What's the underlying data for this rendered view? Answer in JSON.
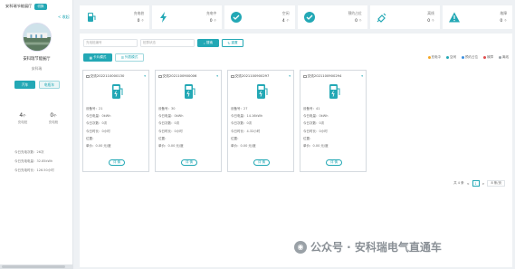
{
  "sidebar": {
    "title": "安科瑞节能展厅",
    "toggle_label": "切换",
    "collapse_label": "< 收起",
    "station_name": "安科瑞节能展厅",
    "station_sub": "安科瑞",
    "btn_primary": "汽车",
    "btn_secondary": "电瓶车",
    "stats": [
      {
        "num": "4",
        "unit": "个",
        "label": "充电桩"
      },
      {
        "num": "0",
        "unit": "个",
        "label": "充电枪"
      }
    ],
    "lines": [
      "今日充电次数：26次",
      "今日充电电量：32.85kWh",
      "今日充电时长：126.50小时"
    ]
  },
  "cards": [
    {
      "label": "充电桩",
      "value": "0",
      "unit": "个",
      "icon": "charger-icon"
    },
    {
      "label": "充电中",
      "value": "0",
      "unit": "个",
      "icon": "lightning-icon"
    },
    {
      "label": "空闲",
      "value": "4",
      "unit": "个",
      "icon": "check-circle-icon"
    },
    {
      "label": "预约占位",
      "value": "0",
      "unit": "个",
      "icon": "check-circle-icon"
    },
    {
      "label": "离线",
      "value": "0",
      "unit": "个",
      "icon": "offline-plug-icon"
    },
    {
      "label": "故障",
      "value": "0",
      "unit": "个",
      "icon": "warning-icon"
    }
  ],
  "filters": {
    "input1_placeholder": "充电桩编号",
    "input2_placeholder": "桩群状态",
    "search_label": "搜索",
    "reset_label": "重置"
  },
  "modes": {
    "card_label": "卡片模式",
    "list_label": "列表模式"
  },
  "legend": [
    {
      "label": "充电中",
      "color": "#f5a623"
    },
    {
      "label": "空闲",
      "color": "#23a8b5"
    },
    {
      "label": "预约占位",
      "color": "#3b8fe0"
    },
    {
      "label": "故障",
      "color": "#e04b4b"
    },
    {
      "label": "离线",
      "color": "#9aa1a7"
    }
  ],
  "piles": [
    {
      "title": "交流2022110000130",
      "port": "21",
      "energy": "0kWh",
      "count": "0次",
      "time": "0小时",
      "location": "",
      "price": "0.00 元/度"
    },
    {
      "title": "交流2021100900006",
      "port": "30",
      "energy": "0kWh",
      "count": "0次",
      "time": "0小时",
      "location": "",
      "price": "0.00 元/度"
    },
    {
      "title": "交流2021100900297",
      "port": "27",
      "energy": "14.16kWh",
      "count": "0次",
      "time": "4.32小时",
      "location": "",
      "price": "0.00 元/度"
    },
    {
      "title": "交流2021100900294",
      "port": "41",
      "energy": "0kWh",
      "count": "0次",
      "time": "0小时",
      "location": "",
      "price": "0.00 元/度"
    }
  ],
  "pile_labels": {
    "port": "设备号：",
    "energy": "今日电量：",
    "count": "今日次数：",
    "time": "今日时长：",
    "location": "位置：",
    "price": "单价：",
    "detail": "详 情"
  },
  "pager": {
    "total": "共 4 条",
    "prev": "<",
    "page": "1",
    "next": ">",
    "size": "8 条/页"
  },
  "watermark": "公众号 · 安科瑞电气直通车"
}
